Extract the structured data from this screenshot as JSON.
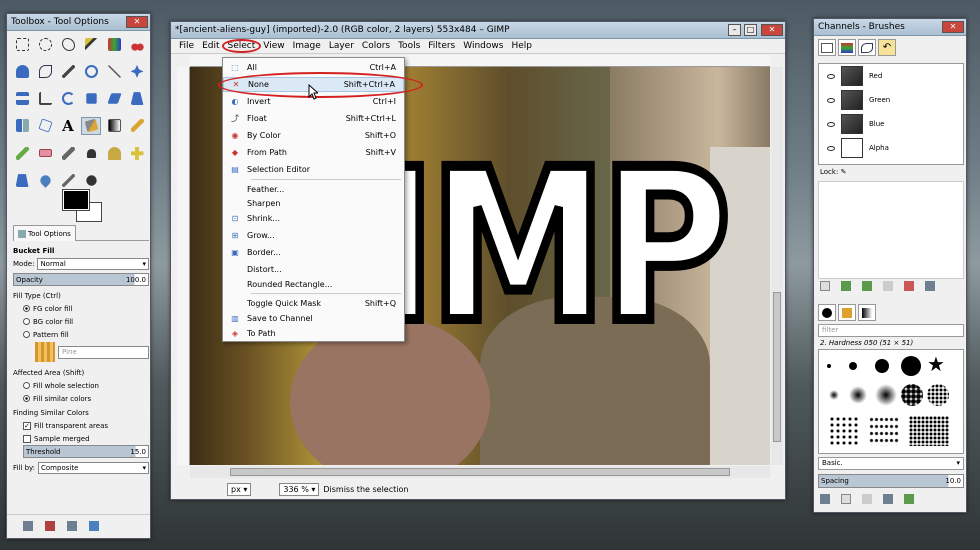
{
  "toolbox": {
    "title": "Toolbox - Tool Options",
    "tab_label": "Tool Options",
    "tool_name": "Bucket Fill",
    "mode_label": "Mode:",
    "mode_value": "Normal",
    "opacity_label": "Opacity",
    "opacity_value": "100.0",
    "fill_type_label": "Fill Type  (Ctrl)",
    "fg_fill": "FG color fill",
    "bg_fill": "BG color fill",
    "pattern_fill": "Pattern fill",
    "pattern_name": "Pine",
    "affected_label": "Affected Area  (Shift)",
    "whole_sel": "Fill whole selection",
    "similar": "Fill similar colors",
    "finding_label": "Finding Similar Colors",
    "transparent": "Fill transparent areas",
    "sample": "Sample merged",
    "threshold_label": "Threshold",
    "threshold_value": "15.0",
    "fillby_label": "Fill by:",
    "fillby_value": "Composite"
  },
  "image_window": {
    "title": "*[ancient-aliens-guy] (imported)-2.0 (RGB color, 2 layers) 553x484 – GIMP",
    "menus": [
      "File",
      "Edit",
      "Select",
      "View",
      "Image",
      "Layer",
      "Colors",
      "Tools",
      "Filters",
      "Windows",
      "Help"
    ],
    "canvas_text": "GIMP",
    "unit": "px",
    "zoom": "336 %",
    "status": "Dismiss the selection"
  },
  "select_menu": {
    "items": [
      {
        "label": "All",
        "shortcut": "Ctrl+A",
        "icon": "select-all-icon"
      },
      {
        "label": "None",
        "shortcut": "Shift+Ctrl+A",
        "icon": "select-none-icon"
      },
      {
        "label": "Invert",
        "shortcut": "Ctrl+I",
        "icon": "invert-icon"
      },
      {
        "label": "Float",
        "shortcut": "Shift+Ctrl+L",
        "icon": "float-icon"
      },
      {
        "label": "By Color",
        "shortcut": "Shift+O",
        "icon": "by-color-icon"
      },
      {
        "label": "From Path",
        "shortcut": "Shift+V",
        "icon": "from-path-icon"
      },
      {
        "label": "Selection Editor",
        "shortcut": "",
        "icon": "selection-editor-icon"
      },
      {
        "label": "Feather...",
        "shortcut": "",
        "icon": ""
      },
      {
        "label": "Sharpen",
        "shortcut": "",
        "icon": ""
      },
      {
        "label": "Shrink...",
        "shortcut": "",
        "icon": "shrink-icon"
      },
      {
        "label": "Grow...",
        "shortcut": "",
        "icon": "grow-icon"
      },
      {
        "label": "Border...",
        "shortcut": "",
        "icon": "border-icon"
      },
      {
        "label": "Distort...",
        "shortcut": "",
        "icon": ""
      },
      {
        "label": "Rounded Rectangle...",
        "shortcut": "",
        "icon": ""
      },
      {
        "label": "Toggle Quick Mask",
        "shortcut": "Shift+Q",
        "icon": ""
      },
      {
        "label": "Save to Channel",
        "shortcut": "",
        "icon": "save-channel-icon"
      },
      {
        "label": "To Path",
        "shortcut": "",
        "icon": "to-path-icon"
      }
    ]
  },
  "channels": {
    "title": "Channels - Brushes",
    "list": [
      "Red",
      "Green",
      "Blue",
      "Alpha"
    ],
    "lock_label": "Lock:",
    "filter_placeholder": "filter",
    "brush_name": "2. Hardness 050 (51 × 51)",
    "preset": "Basic.",
    "spacing_label": "Spacing",
    "spacing_value": "10.0"
  },
  "colors": {
    "highlight": "#d32020",
    "menu_hover": "#dbe8f6"
  }
}
